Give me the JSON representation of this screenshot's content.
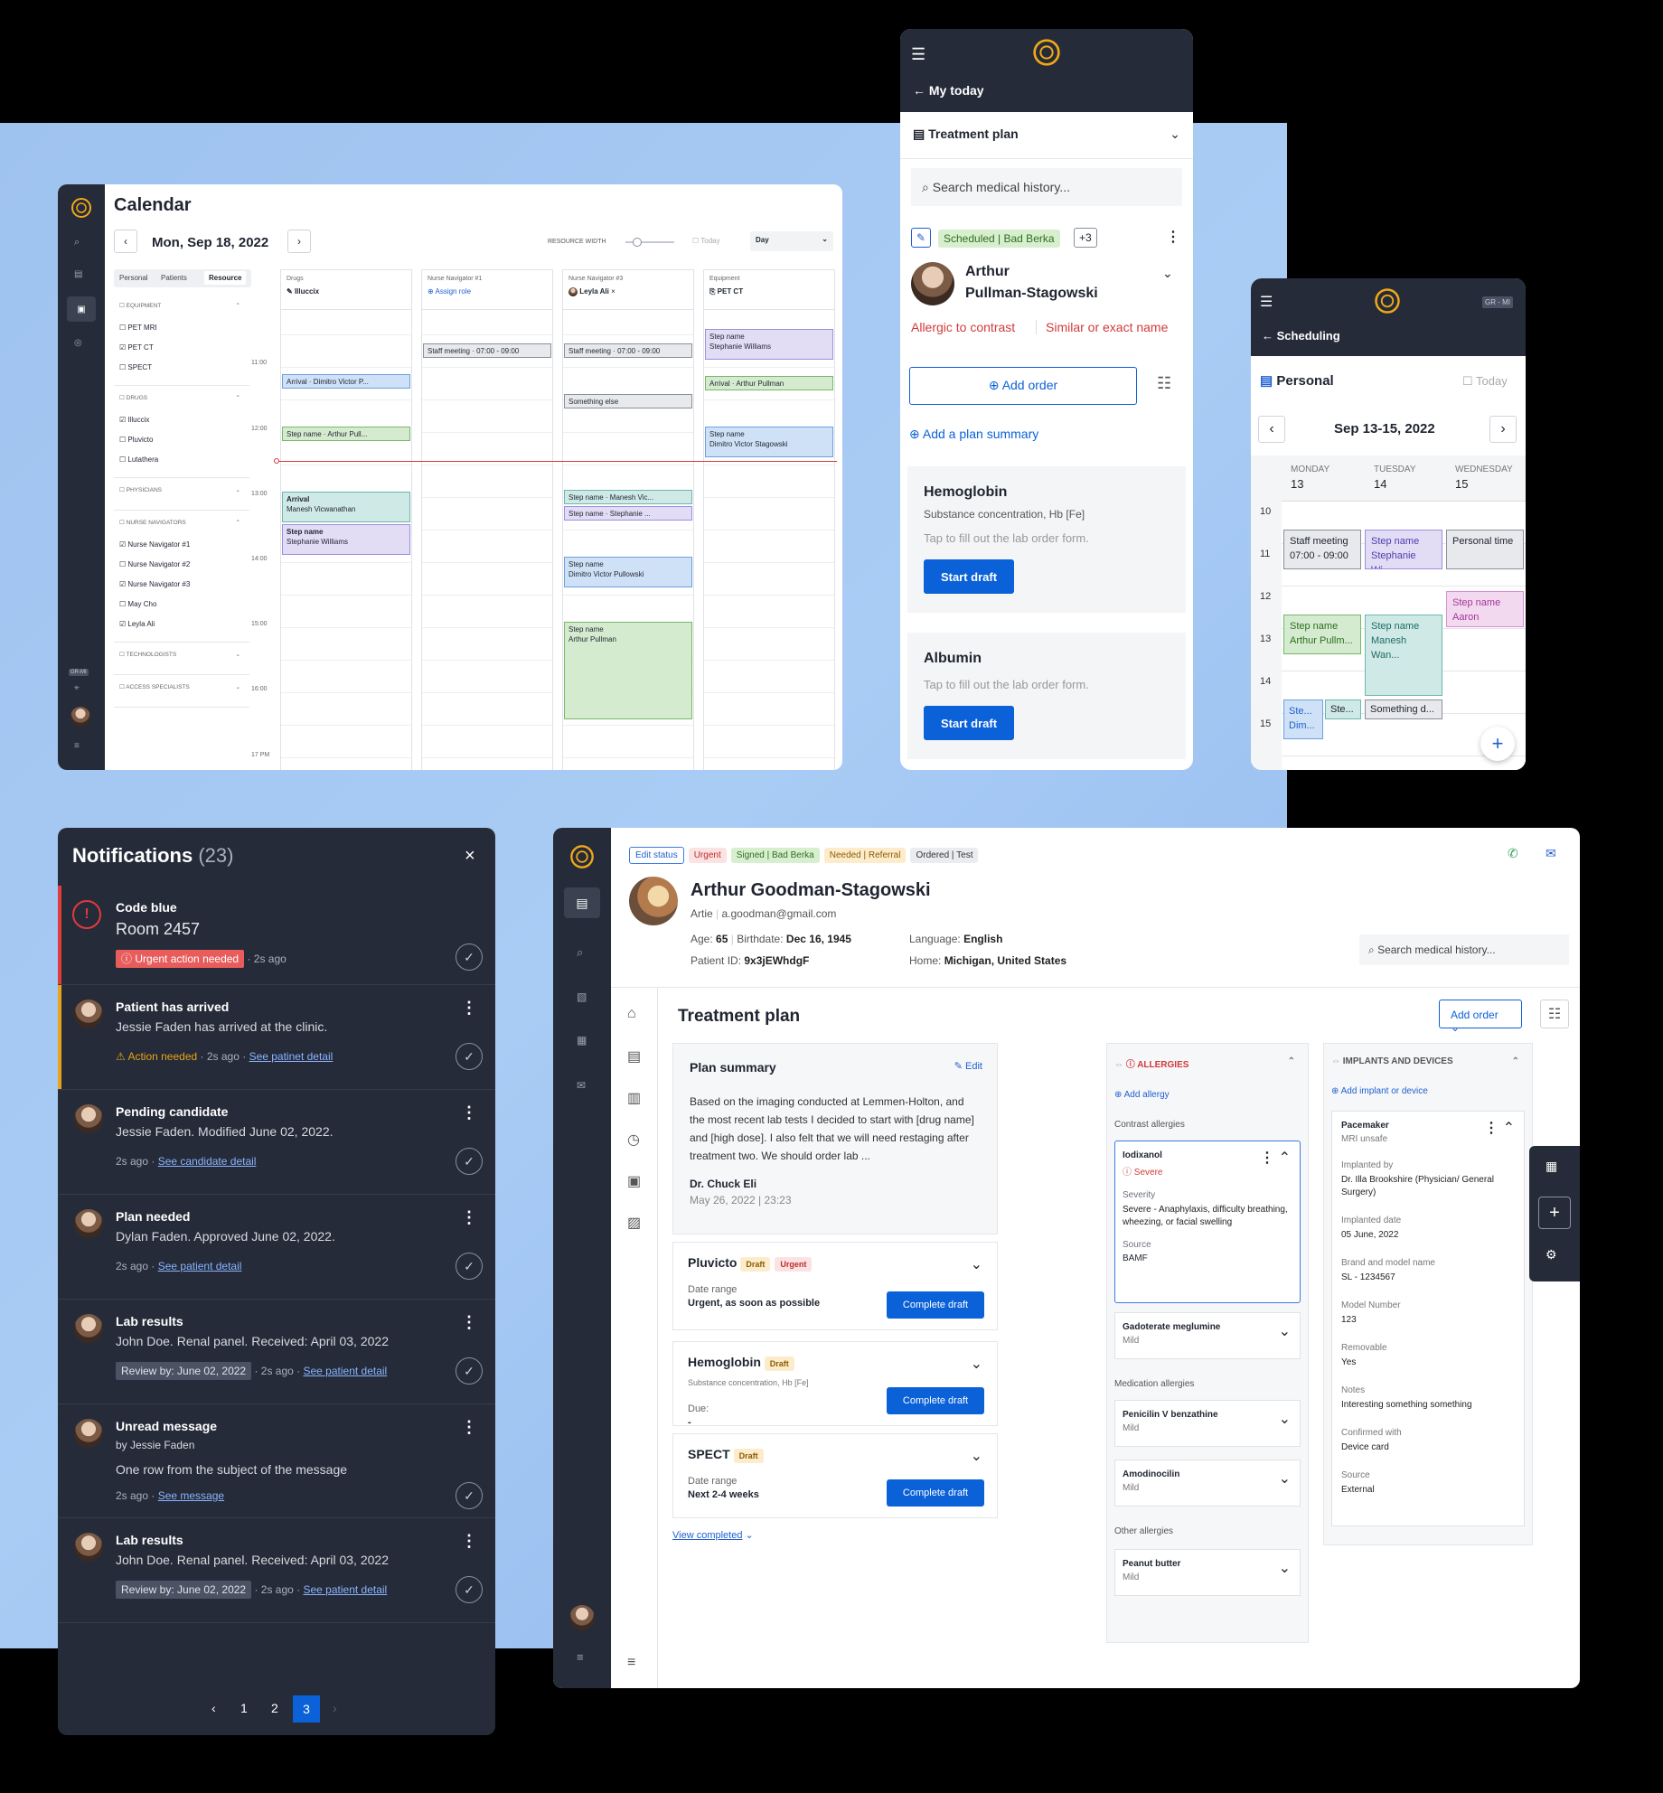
{
  "calendar": {
    "title": "Calendar",
    "date": "Mon, Sep 18, 2022",
    "resource_width_label": "RESOURCE WIDTH",
    "today_label": "Today",
    "view": "Day",
    "tabs": [
      "Personal",
      "Patients",
      "Resource"
    ],
    "groups": [
      {
        "name": "EQUIPMENT",
        "items": [
          {
            "label": "PET MRI",
            "checked": false
          },
          {
            "label": "PET CT",
            "checked": true
          },
          {
            "label": "SPECT",
            "checked": false
          }
        ]
      },
      {
        "name": "DRUGS",
        "items": [
          {
            "label": "Illuccix",
            "checked": true
          },
          {
            "label": "Pluvicto",
            "checked": false
          },
          {
            "label": "Lutathera",
            "checked": false
          }
        ]
      },
      {
        "name": "PHYSICIANS",
        "items": []
      },
      {
        "name": "NURSE NAVIGATORS",
        "items": [
          {
            "label": "Nurse Navigator #1",
            "checked": true
          },
          {
            "label": "Nurse Navigator #2",
            "checked": false
          },
          {
            "label": "Nurse Navigator #3",
            "checked": true
          },
          {
            "label": "May Cho",
            "checked": false
          },
          {
            "label": "Leyla Ali",
            "checked": true
          }
        ]
      },
      {
        "name": "TECHNOLOGISTS",
        "items": []
      },
      {
        "name": "ACCESS SPECIALISTS",
        "items": []
      }
    ],
    "badge": "GR-MI",
    "columns": [
      {
        "head": "Drugs",
        "sub": "Illuccix"
      },
      {
        "head": "Nurse Navigator #1",
        "sub": "Assign role"
      },
      {
        "head": "Nurse Navigator #3",
        "sub": "Leyla Ali"
      },
      {
        "head": "Equipment",
        "sub": "PET CT"
      }
    ],
    "times": [
      "11:00",
      "12:00",
      "13:00",
      "14:00",
      "15:00",
      "16:00",
      "17 PM"
    ],
    "events": {
      "e1": "Arrival · Dimitro Victor P...",
      "e2": "Step name · Arthur Pull...",
      "e3a": "Arrival",
      "e3b": "Manesh Vicwanathan",
      "e4a": "Step name",
      "e4b": "Stephanie Williams",
      "e5": "Staff meeting · 07:00 - 09:00",
      "e6": "Staff meeting · 07:00 - 09:00",
      "e7": "Something else",
      "e8": "Step name · Manesh Vic...",
      "e9": "Step name · Stephanie ...",
      "e10a": "Step name",
      "e10b": "Dimitro Victor Pullowski",
      "e11a": "Step name",
      "e11b": "Arthur Pullman",
      "e12a": "Step name",
      "e12b": "Stephanie Williams",
      "e13": "Arrival · Arthur Pullman",
      "e14a": "Step name",
      "e14b": "Dimitro Victor Stagowski"
    }
  },
  "mobile1": {
    "back": "My today",
    "section": "Treatment plan",
    "search": "Search medical history...",
    "status_chip": "Scheduled | Bad Berka",
    "more_chip": "+3",
    "patient_first": "Arthur",
    "patient_last": "Pullman-Stagowski",
    "allergy1": "Allergic to contrast",
    "allergy2": "Similar or exact name",
    "add_order": "Add order",
    "add_summary": "Add a plan summary",
    "orders": [
      {
        "title": "Hemoglobin",
        "sub": "Substance concentration, Hb [Fe]",
        "hint": "Tap to fill out the lab order form.",
        "btn": "Start draft"
      },
      {
        "title": "Albumin",
        "sub": "",
        "hint": "Tap to fill out the lab order form.",
        "btn": "Start draft"
      }
    ]
  },
  "mobile2": {
    "back": "Scheduling",
    "badge": "GR - MI",
    "view": "Personal",
    "today": "Today",
    "range": "Sep 13-15, 2022",
    "days": [
      {
        "name": "MONDAY",
        "num": "13"
      },
      {
        "name": "TUESDAY",
        "num": "14"
      },
      {
        "name": "WEDNESDAY",
        "num": "15"
      }
    ],
    "hours": [
      "10",
      "11",
      "12",
      "13",
      "14",
      "15"
    ],
    "events": {
      "a1": "Staff meeting",
      "a2": "07:00 - 09:00",
      "b1": "Step name",
      "b2": "Stephanie Wi...",
      "c1": "Personal time",
      "d1": "Step name",
      "d2": "Aaron Nickolas",
      "e1": "Step name",
      "e2": "Arthur Pullm...",
      "f1": "Step name",
      "f2": "Manesh Wan...",
      "g1": "Ste...",
      "g2": "Dim...",
      "h1": "Ste...",
      "i1": "Something d..."
    }
  },
  "notifications": {
    "title": "Notifications",
    "count": "(23)",
    "items": [
      {
        "title": "Code blue",
        "body": "Room 2457",
        "tag": "Urgent action needed",
        "time": "· 2s ago",
        "link": ""
      },
      {
        "title": "Patient has arrived",
        "body": "Jessie Faden has arrived at the clinic.",
        "tag": "Action needed",
        "time": "· 2s ago ·",
        "link": "See patinet detail"
      },
      {
        "title": "Pending candidate",
        "body": "Jessie Faden. Modified June 02, 2022.",
        "tag": "",
        "time": "2s ago ·",
        "link": "See candidate detail"
      },
      {
        "title": "Plan needed",
        "body": "Dylan Faden. Approved June 02, 2022.",
        "tag": "",
        "time": "2s ago ·",
        "link": "See patient detail"
      },
      {
        "title": "Lab results",
        "body": "John Doe. Renal panel. Received: April 03, 2022",
        "tag": "Review by: June 02, 2022",
        "time": "· 2s ago ·",
        "link": "See patient detail"
      },
      {
        "title": "Unread message",
        "body": "by Jessie Faden",
        "body2": "One row from the subject of the message",
        "tag": "",
        "time": "2s ago ·",
        "link": "See message"
      },
      {
        "title": "Lab results",
        "body": "John Doe. Renal panel. Received: April 03, 2022",
        "tag": "Review by: June 02, 2022",
        "time": "· 2s ago ·",
        "link": "See patient detail"
      }
    ],
    "pages": [
      "1",
      "2",
      "3"
    ]
  },
  "record": {
    "chips": [
      "Edit status",
      "Urgent",
      "Signed | Bad Berka",
      "Needed | Referral",
      "Ordered | Test"
    ],
    "name": "Arthur Goodman-Stagowski",
    "nick": "Artie",
    "email": "a.goodman@gmail.com",
    "age_label": "Age:",
    "age": "65",
    "birth_label": "Birthdate:",
    "birth": "Dec 16, 1945",
    "id_label": "Patient ID:",
    "pid": "9x3jEWhdgF",
    "lang_label": "Language:",
    "lang": "English",
    "home_label": "Home:",
    "home": "Michigan, United States",
    "search": "Search medical history...",
    "plan_title": "Treatment plan",
    "add_order": "Add order",
    "summary": {
      "title": "Plan summary",
      "edit": "Edit",
      "text": "Based on the imaging conducted at Lemmen-Holton, and the most recent lab tests I decided to start with [drug name] and [high dose]. I also felt that we will need restaging after treatment two. We should order lab ...",
      "author": "Dr. Chuck Eli",
      "date": "May 26, 2022 | 23:23"
    },
    "orders": [
      {
        "title": "Pluvicto",
        "chips": [
          "Draft",
          "Urgent"
        ],
        "sub": "",
        "label": "Date range",
        "value": "Urgent, as soon as possible",
        "btn": "Complete draft"
      },
      {
        "title": "Hemoglobin",
        "chips": [
          "Draft"
        ],
        "sub": "Substance concentration, Hb [Fe]",
        "label": "Due:",
        "value": "-",
        "btn": "Complete draft"
      },
      {
        "title": "SPECT",
        "chips": [
          "Draft"
        ],
        "sub": "",
        "label": "Date range",
        "value": "Next 2-4 weeks",
        "btn": "Complete draft"
      }
    ],
    "view_completed": "View completed",
    "allergies": {
      "title": "ALLERGIES",
      "add": "Add allergy",
      "contrast": "Contrast allergies",
      "iod": {
        "name": "Iodixanol",
        "sev": "Severe",
        "sev_label": "Severity",
        "sev_val": "Severe - Anaphylaxis, difficulty breathing, wheezing, or facial swelling",
        "src_label": "Source",
        "src": "BAMF"
      },
      "gad": {
        "name": "Gadoterate meglumine",
        "sev": "Mild"
      },
      "med": "Medication allergies",
      "pen": {
        "name": "Penicilin V benzathine",
        "sev": "Mild"
      },
      "amo": {
        "name": "Amodinocilin",
        "sev": "Mild"
      },
      "other": "Other allergies",
      "pea": {
        "name": "Peanut butter",
        "sev": "Mild"
      }
    },
    "implants": {
      "title": "IMPLANTS AND DEVICES",
      "add": "Add implant or device",
      "name": "Pacemaker",
      "sub": "MRI unsafe",
      "fields": [
        {
          "l": "Implanted by",
          "v": "Dr. Illa Brookshire (Physician/ General Surgery)"
        },
        {
          "l": "Implanted date",
          "v": "05 June, 2022"
        },
        {
          "l": "Brand and model name",
          "v": "SL - 1234567"
        },
        {
          "l": "Model Number",
          "v": "123"
        },
        {
          "l": "Removable",
          "v": "Yes"
        },
        {
          "l": "Notes",
          "v": "Interesting something something"
        },
        {
          "l": "Confirmed with",
          "v": "Device card"
        },
        {
          "l": "Source",
          "v": "External"
        }
      ]
    }
  },
  "colors": {
    "accent": "#0b61d8",
    "dark": "#252b38",
    "urgent": "#e23b3b",
    "warning": "#e8a31b"
  }
}
